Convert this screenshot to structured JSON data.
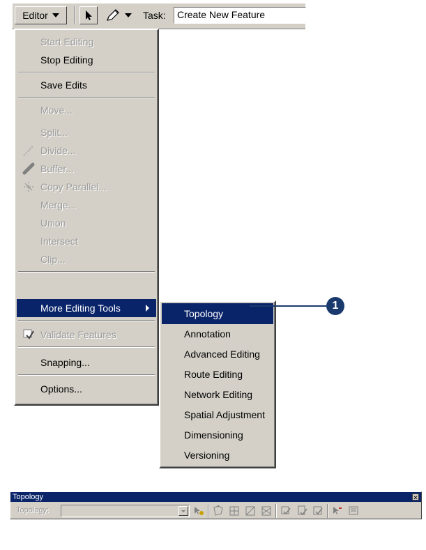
{
  "toolbar": {
    "editor_label": "Editor",
    "task_label": "Task:",
    "task_value": "Create New Feature"
  },
  "main_menu": {
    "start_editing": "Start Editing",
    "stop_editing": "Stop Editing",
    "save_edits": "Save Edits",
    "move": "Move...",
    "split": "Split...",
    "divide": "Divide...",
    "buffer": "Buffer...",
    "copy_parallel": "Copy Parallel...",
    "merge": "Merge...",
    "union": "Union",
    "intersect": "Intersect",
    "clip": "Clip...",
    "more_editing_tools": "More Editing Tools",
    "validate_features": "Validate Features",
    "snapping": "Snapping...",
    "options": "Options..."
  },
  "sub_menu": {
    "items": [
      "Topology",
      "Annotation",
      "Advanced Editing",
      "Route Editing",
      "Network Editing",
      "Spatial Adjustment",
      "Dimensioning",
      "Versioning"
    ]
  },
  "callout": {
    "number": "1"
  },
  "topology_toolbar": {
    "title": "Topology",
    "label": "Topology:",
    "combo_value": ""
  },
  "colors": {
    "menu_bg": "#d4d0c8",
    "highlight": "#0a246a",
    "disabled_text": "#9a9a9a"
  }
}
